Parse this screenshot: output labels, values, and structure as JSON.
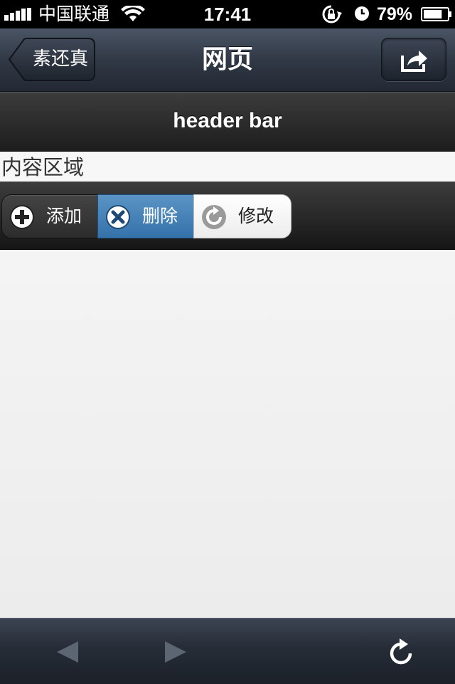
{
  "status_bar": {
    "carrier": "中国联通",
    "time": "17:41",
    "battery_percent": "79%",
    "battery_level": 0.79,
    "icons": [
      "signal-icon",
      "wifi-icon",
      "rotation-lock-icon",
      "alarm-icon",
      "battery-icon"
    ]
  },
  "nav_bar": {
    "back_label": "素还真",
    "title": "网页",
    "share_icon": "share-icon"
  },
  "header_bar": {
    "title": "header bar"
  },
  "content": {
    "label": "内容区域"
  },
  "toolbar": {
    "buttons": [
      {
        "label": "添加",
        "icon": "plus-icon"
      },
      {
        "label": "删除",
        "icon": "delete-icon"
      },
      {
        "label": "修改",
        "icon": "refresh-icon"
      }
    ],
    "active_button_color": "#3a78b0"
  },
  "bottom_bar": {
    "icons": [
      "back-arrow-icon",
      "forward-arrow-icon",
      "reload-icon"
    ]
  }
}
